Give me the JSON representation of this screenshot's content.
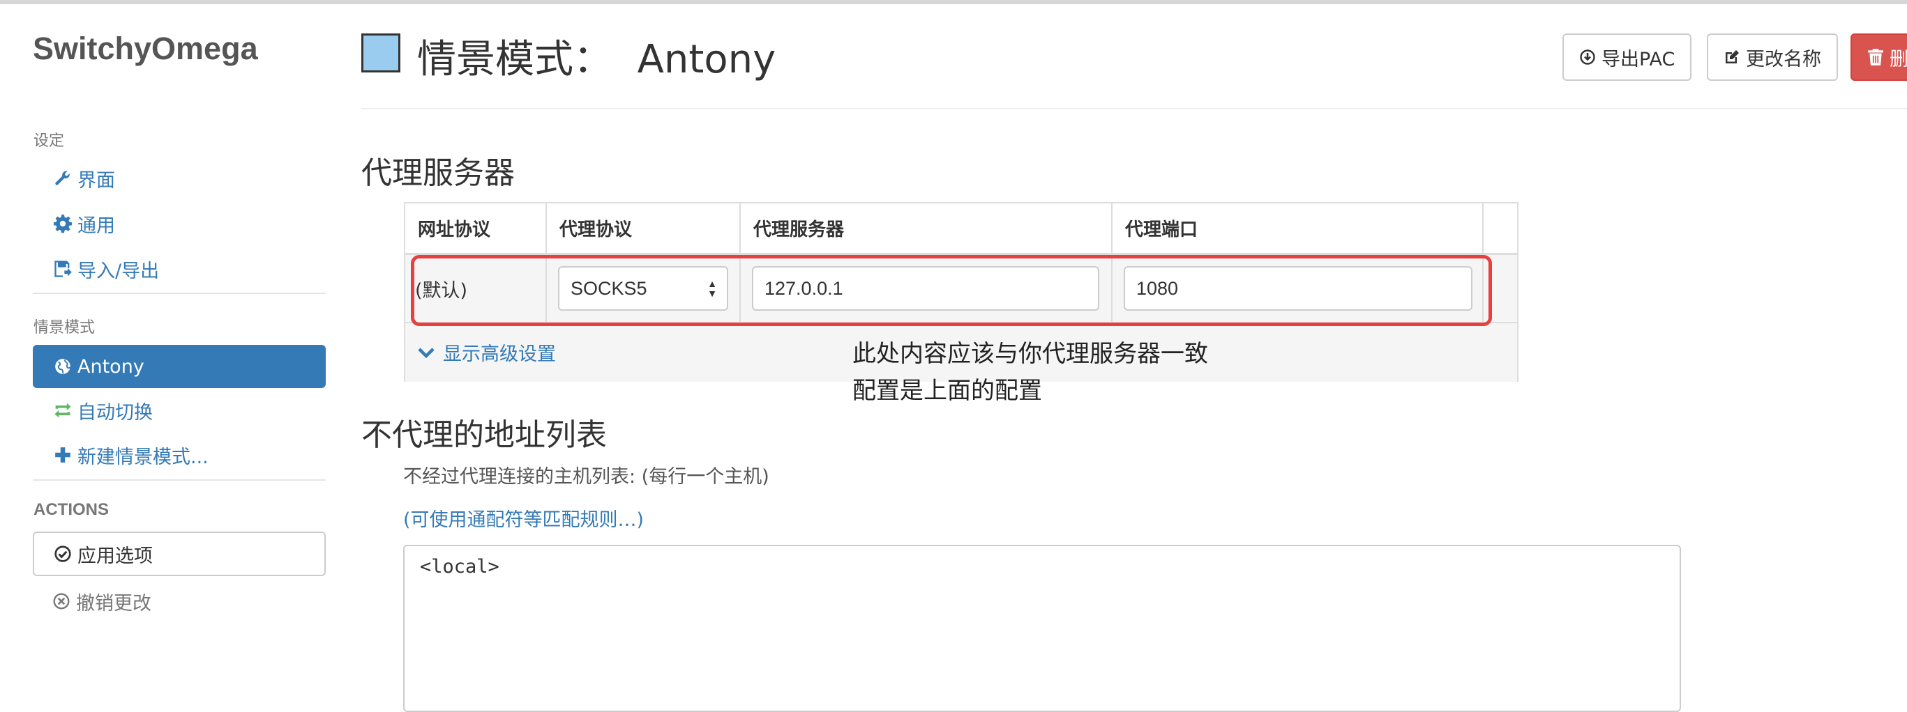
{
  "app": {
    "brand": "SwitchyOmega"
  },
  "sidebar": {
    "settings_heading": "设定",
    "settings_items": [
      {
        "label": "界面",
        "icon": "wrench-icon"
      },
      {
        "label": "通用",
        "icon": "gear-icon"
      },
      {
        "label": "导入/导出",
        "icon": "import-export-icon"
      }
    ],
    "profiles_heading": "情景模式",
    "profile_items": [
      {
        "label": "Antony",
        "icon": "globe-icon",
        "active": true
      },
      {
        "label": "自动切换",
        "icon": "switch-icon",
        "active": false
      },
      {
        "label": "新建情景模式...",
        "icon": "plus-icon",
        "active": false
      }
    ],
    "actions_heading": "ACTIONS",
    "apply_label": "应用选项",
    "revert_label": "撤销更改"
  },
  "header": {
    "title": "情景模式：  Antony",
    "profile_color": "#99ccee",
    "export_pac_label": "导出PAC",
    "rename_label": "更改名称",
    "delete_label": "删"
  },
  "proxy": {
    "heading": "代理服务器",
    "columns": [
      "网址协议",
      "代理协议",
      "代理服务器",
      "代理端口"
    ],
    "row": {
      "scheme": "(默认)",
      "protocol": "SOCKS5",
      "server": "127.0.0.1",
      "port": "1080"
    },
    "advanced_label": "显示高级设置",
    "annotation_line1": "此处内容应该与你代理服务器一致",
    "annotation_line2": "配置是上面的配置"
  },
  "bypass": {
    "heading": "不代理的地址列表",
    "hint": "不经过代理连接的主机列表: (每行一个主机)",
    "wildcard_link": "(可使用通配符等匹配规则…)",
    "value": "<local>"
  },
  "colors": {
    "accent": "#337ab7",
    "danger": "#d9534f",
    "annotation_box": "#e8403f",
    "switch_icon": "#5cb85c"
  }
}
